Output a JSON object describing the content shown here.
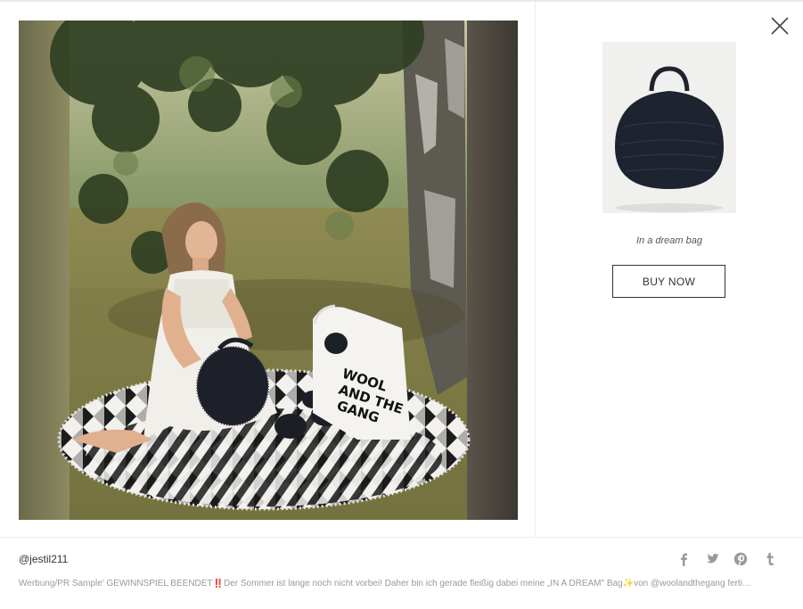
{
  "lightbox": {
    "close_label": "",
    "photo": {
      "alt": ""
    }
  },
  "product": {
    "name": "In a dream bag",
    "buy_label": "BUY NOW",
    "bag_print": "WOOL AND THE GANG"
  },
  "post": {
    "username": "@jestil211",
    "caption": "Werbung/PR Sample' GEWINNSPIEL BEENDET‼️Der Sommer ist lange noch nicht vorbei! Daher bin ich gerade fleißig dabei meine „IN A DREAM\" Bag✨von @woolandthegang ferti…"
  },
  "share": [
    {
      "name": "facebook-icon"
    },
    {
      "name": "twitter-icon"
    },
    {
      "name": "pinterest-icon"
    },
    {
      "name": "tumblr-icon"
    }
  ],
  "colors": {
    "icon_gray": "#9a9a9a",
    "button_border": "#333333",
    "caption_gray": "#999999"
  }
}
